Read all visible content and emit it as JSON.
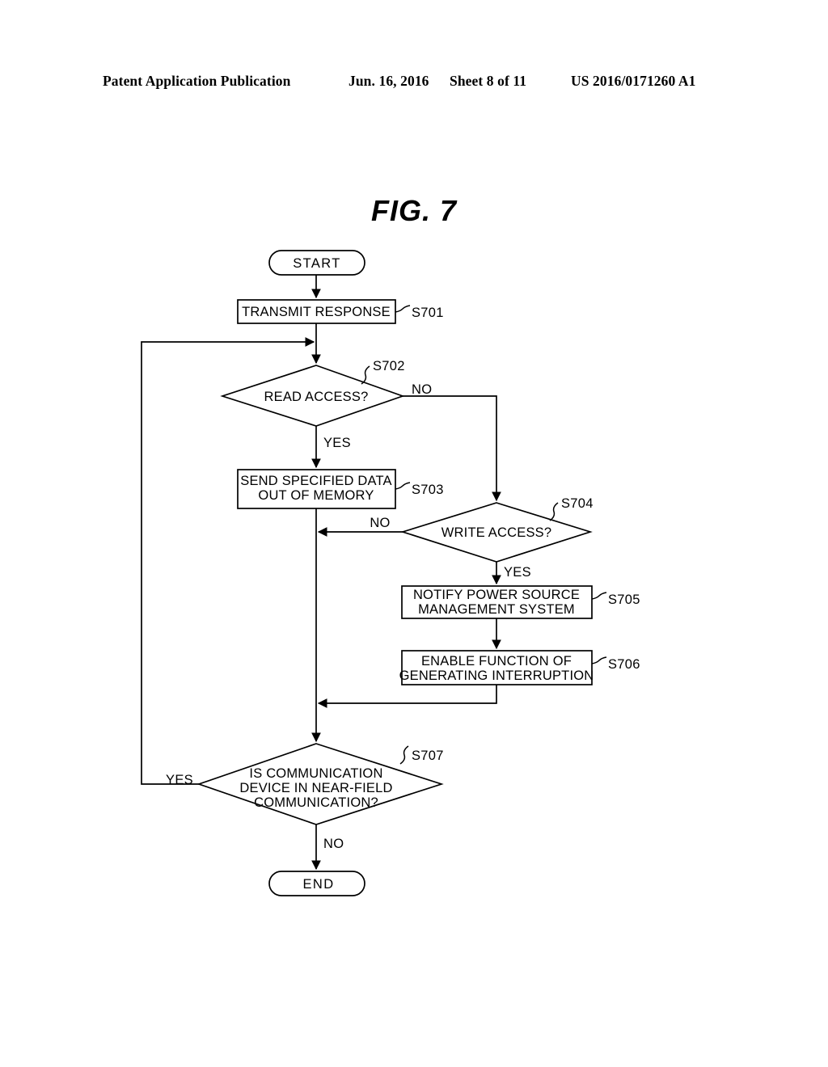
{
  "header": {
    "publication": "Patent Application Publication",
    "date": "Jun. 16, 2016",
    "sheet": "Sheet 8 of 11",
    "number": "US 2016/0171260 A1"
  },
  "figure": {
    "title": "FIG. 7"
  },
  "flowchart": {
    "nodes": {
      "start": {
        "label": "START"
      },
      "s701": {
        "label": "TRANSMIT RESPONSE",
        "id": "S701"
      },
      "s702": {
        "label": "READ ACCESS?",
        "id": "S702"
      },
      "s703": {
        "line1": "SEND SPECIFIED DATA",
        "line2": "OUT OF MEMORY",
        "id": "S703"
      },
      "s704": {
        "label": "WRITE ACCESS?",
        "id": "S704"
      },
      "s705": {
        "line1": "NOTIFY POWER SOURCE",
        "line2": "MANAGEMENT SYSTEM",
        "id": "S705"
      },
      "s706": {
        "line1": "ENABLE FUNCTION OF",
        "line2": "GENERATING INTERRUPTION",
        "id": "S706"
      },
      "s707": {
        "line1": "IS COMMUNICATION",
        "line2": "DEVICE IN NEAR-FIELD",
        "line3": "COMMUNICATION?",
        "id": "S707"
      },
      "end": {
        "label": "END"
      }
    },
    "branches": {
      "s702_no": "NO",
      "s702_yes": "YES",
      "s704_no": "NO",
      "s704_yes": "YES",
      "s707_yes": "YES",
      "s707_no": "NO"
    },
    "colors": {
      "stroke": "#000000",
      "fill": "#ffffff",
      "text": "#000000"
    }
  }
}
